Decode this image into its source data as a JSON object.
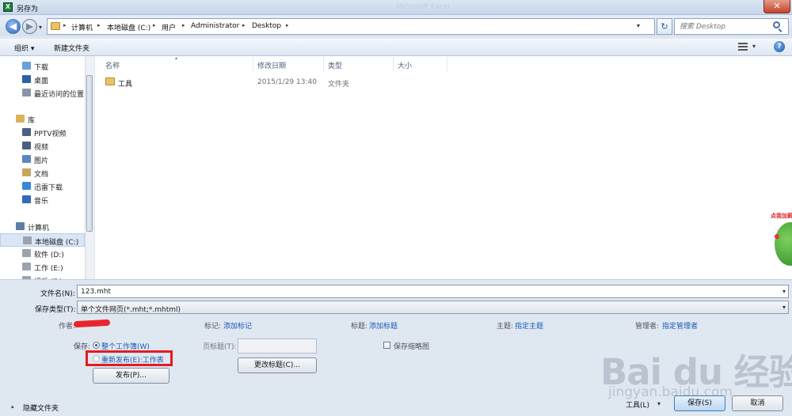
{
  "window": {
    "title": "另存为",
    "faded_title": "Microsoft Excel",
    "close_label": "✕"
  },
  "address": {
    "crumbs": [
      "计算机",
      "本地磁盘 (C:)",
      "用户",
      "Administrator",
      "Desktop"
    ],
    "search_placeholder": "搜索 Desktop"
  },
  "toolbar": {
    "organize": "组织 ▾",
    "new_folder": "新建文件夹",
    "help": "?"
  },
  "nav": {
    "items": [
      {
        "label": "下载",
        "icon": "download-folder-icon",
        "color": "#6aa0e0",
        "top": false
      },
      {
        "label": "桌面",
        "icon": "desktop-icon",
        "color": "#2c5fa8",
        "top": false
      },
      {
        "label": "最近访问的位置",
        "icon": "recent-places-icon",
        "color": "#8a96a8",
        "top": false
      },
      {
        "label": "库",
        "icon": "library-icon",
        "color": "#d9b25c",
        "top": true
      },
      {
        "label": "PPTV视频",
        "icon": "video-library-icon",
        "color": "#4b5f80",
        "top": false
      },
      {
        "label": "视频",
        "icon": "video-library-icon",
        "color": "#4b5f80",
        "top": false
      },
      {
        "label": "图片",
        "icon": "pictures-icon",
        "color": "#5a88c2",
        "top": false
      },
      {
        "label": "文档",
        "icon": "documents-icon",
        "color": "#c9a55a",
        "top": false
      },
      {
        "label": "迅雷下载",
        "icon": "thunder-download-icon",
        "color": "#3a86d8",
        "top": false
      },
      {
        "label": "音乐",
        "icon": "music-icon",
        "color": "#2d6cb8",
        "top": false
      },
      {
        "label": "计算机",
        "icon": "computer-icon",
        "color": "#5d7ea8",
        "top": true
      },
      {
        "label": "本地磁盘 (C:)",
        "icon": "drive-icon",
        "color": "#9aa3ae",
        "top": false,
        "selected": true
      },
      {
        "label": "软件 (D:)",
        "icon": "drive-icon",
        "color": "#9aa3ae",
        "top": false
      },
      {
        "label": "工作 (E:)",
        "icon": "drive-icon",
        "color": "#9aa3ae",
        "top": false
      },
      {
        "label": "娱乐 (F:)",
        "icon": "drive-icon",
        "color": "#9aa3ae",
        "top": false
      }
    ]
  },
  "columns": {
    "name": "名称",
    "modified": "修改日期",
    "type": "类型",
    "size": "大小"
  },
  "files": [
    {
      "name": "工具",
      "modified": "2015/1/29 13:40",
      "type": "文件夹",
      "size": ""
    }
  ],
  "form": {
    "filename_label": "文件名(N):",
    "filename_value": "123.mht",
    "filetype_label": "保存类型(T):",
    "filetype_value": "单个文件网页(*.mht;*.mhtml)",
    "author_label": "作者:",
    "tags_label": "标记:",
    "tags_link": "添加标记",
    "title_label": "标题:",
    "title_link": "添加标题",
    "subject_label": "主题:",
    "subject_link": "指定主题",
    "manager_label": "管理者:",
    "manager_link": "指定管理者",
    "save_label": "保存:",
    "radio_workbook": "整个工作簿(W)",
    "radio_republish": "重新发布(E):工作表",
    "publish_button": "发布(P)...",
    "page_title_label": "页标题(T):",
    "change_title_button": "更改标题(C)...",
    "thumbnail_label": "保存缩略图"
  },
  "footer": {
    "hide_folders": "隐藏文件夹",
    "tools": "工具(L)",
    "save": "保存(S)",
    "cancel": "取消"
  },
  "watermark": {
    "logo": "Bai du 经验",
    "url": "jingyan.baidu.com"
  },
  "ad": {
    "text": "点我加薪"
  }
}
